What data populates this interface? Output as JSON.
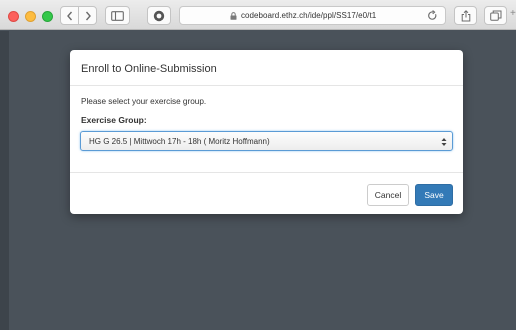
{
  "browser": {
    "url": "codeboard.ethz.ch/ide/ppl/SS17/e0/t1",
    "icons": {
      "back": "chevron-left-icon",
      "forward": "chevron-right-icon",
      "sidebar": "sidebar-icon",
      "extension": "privacy-extension-icon",
      "lock": "lock-icon",
      "reload": "reload-icon",
      "share": "share-icon",
      "tabs": "tabs-icon"
    },
    "traffic_light_colors": {
      "close": "#fc605c",
      "minimize": "#fdbc40",
      "zoom": "#34c84a"
    }
  },
  "modal": {
    "title": "Enroll to Online-Submission",
    "instruction": "Please select your exercise group.",
    "group_label": "Exercise Group:",
    "selected_group": "HG G 26.5 | Mittwoch 17h - 18h ( Moritz Hoffmann)",
    "cancel_label": "Cancel",
    "save_label": "Save"
  },
  "colors": {
    "primary_button": "#337ab7",
    "backdrop": "#4a525a"
  }
}
